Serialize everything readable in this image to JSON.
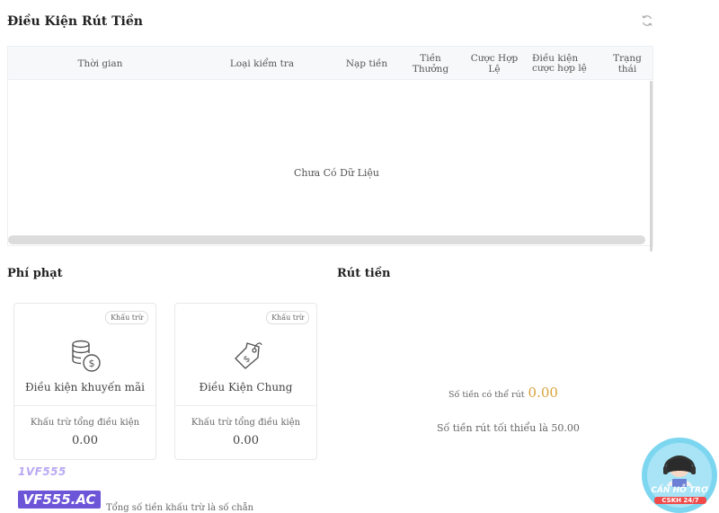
{
  "header": {
    "title": "Điều Kiện Rút Tiền",
    "refresh_icon": "refresh-icon"
  },
  "table": {
    "columns": [
      "Thời gian",
      "Loại kiểm tra",
      "Nạp tiền",
      "Tiền Thưởng",
      "Cược Hợp Lệ",
      "Điều kiện cược hợp lệ",
      "Trạng thái"
    ],
    "empty_text": "Chưa Có Dữ Liệu"
  },
  "penalty": {
    "title": "Phí phạt",
    "cards": [
      {
        "badge": "Khấu trừ",
        "icon": "coins-dollar-icon",
        "title": "Điều kiện khuyến mãi",
        "sub": "Khấu trừ tổng điều kiện",
        "value": "0.00"
      },
      {
        "badge": "Khấu trừ",
        "icon": "price-tag-dollar-icon",
        "title": "Điều Kiện Chung",
        "sub": "Khấu trừ tổng điều kiện",
        "value": "0.00"
      }
    ],
    "footnote": "Tổng số tiền khấu trừ là số chẵn"
  },
  "withdraw": {
    "title": "Rút tiền",
    "available_label": "Số tiền có thể rút",
    "available_value": "0.00",
    "min_text": "Số tiền rút tối thiểu là 50.00"
  },
  "brand": {
    "logo_top": "1VF555",
    "logo_text": "VF555.AC"
  },
  "support": {
    "label": "CẦN HỖ TRỢ",
    "sub": "CSKH 24/7"
  },
  "colors": {
    "accent": "#d8a23a",
    "brand": "#6d55d8"
  }
}
